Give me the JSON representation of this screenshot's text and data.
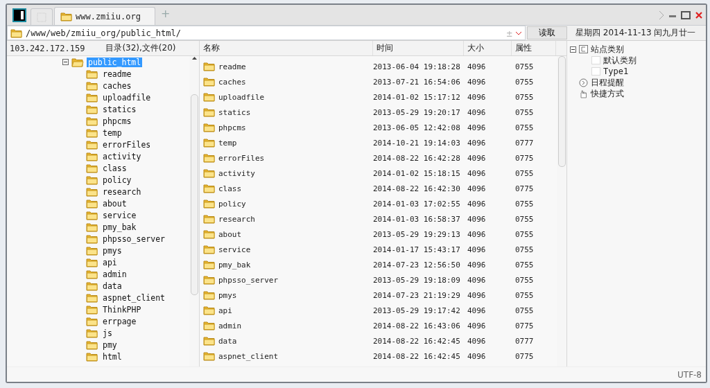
{
  "tabs": [
    {
      "kind": "blank",
      "selected": false
    },
    {
      "kind": "site",
      "label": "www.zmiiu.org",
      "selected": true
    }
  ],
  "new_tab_symbol": "+",
  "address": {
    "value": "/www/web/zmiiu_org/public_html/",
    "toggle_symbol": "±",
    "button": "读取"
  },
  "date_line": "星期四 2014-11-13 闰九月廿一",
  "tree_header": {
    "host": "103.242.172.159",
    "summary": "目录(32),文件(20)"
  },
  "tree": [
    {
      "label": "public_html",
      "expanded": true,
      "selected": true,
      "children": [
        {
          "label": "readme",
          "selected": false
        },
        {
          "label": "caches",
          "selected": false
        },
        {
          "label": "uploadfile",
          "selected": false
        },
        {
          "label": "statics",
          "selected": false
        },
        {
          "label": "phpcms",
          "selected": false
        },
        {
          "label": "temp",
          "selected": false
        },
        {
          "label": "errorFiles",
          "selected": false
        },
        {
          "label": "activity",
          "selected": false
        },
        {
          "label": "class",
          "selected": false
        },
        {
          "label": "policy",
          "selected": false
        },
        {
          "label": "research",
          "selected": false
        },
        {
          "label": "about",
          "selected": false
        },
        {
          "label": "service",
          "selected": false
        },
        {
          "label": "pmy_bak",
          "selected": false
        },
        {
          "label": "phpsso_server",
          "selected": false
        },
        {
          "label": "pmys",
          "selected": false
        },
        {
          "label": "api",
          "selected": false
        },
        {
          "label": "admin",
          "selected": false
        },
        {
          "label": "data",
          "selected": false
        },
        {
          "label": "aspnet_client",
          "selected": false
        },
        {
          "label": "ThinkPHP",
          "selected": false
        },
        {
          "label": "errpage",
          "selected": false
        },
        {
          "label": "js",
          "selected": false
        },
        {
          "label": "pmy",
          "selected": false
        },
        {
          "label": "html",
          "selected": false
        }
      ]
    }
  ],
  "table": {
    "columns": [
      "名称",
      "时间",
      "大小",
      "属性"
    ],
    "rows": [
      [
        "readme",
        "2013-06-04 19:18:28",
        "4096",
        "0755"
      ],
      [
        "caches",
        "2013-07-21 16:54:06",
        "4096",
        "0755"
      ],
      [
        "uploadfile",
        "2014-01-02 15:17:12",
        "4096",
        "0755"
      ],
      [
        "statics",
        "2013-05-29 19:20:17",
        "4096",
        "0755"
      ],
      [
        "phpcms",
        "2013-06-05 12:42:08",
        "4096",
        "0755"
      ],
      [
        "temp",
        "2014-10-21 19:14:03",
        "4096",
        "0777"
      ],
      [
        "errorFiles",
        "2014-08-22 16:42:28",
        "4096",
        "0775"
      ],
      [
        "activity",
        "2014-01-02 15:18:15",
        "4096",
        "0755"
      ],
      [
        "class",
        "2014-08-22 16:42:30",
        "4096",
        "0775"
      ],
      [
        "policy",
        "2014-01-03 17:02:55",
        "4096",
        "0755"
      ],
      [
        "research",
        "2014-01-03 16:58:37",
        "4096",
        "0755"
      ],
      [
        "about",
        "2013-05-29 19:29:13",
        "4096",
        "0755"
      ],
      [
        "service",
        "2014-01-17 15:43:17",
        "4096",
        "0755"
      ],
      [
        "pmy_bak",
        "2014-07-23 12:56:50",
        "4096",
        "0755"
      ],
      [
        "phpsso_server",
        "2013-05-29 19:18:09",
        "4096",
        "0755"
      ],
      [
        "pmys",
        "2014-07-23 21:19:29",
        "4096",
        "0755"
      ],
      [
        "api",
        "2013-05-29 19:17:42",
        "4096",
        "0755"
      ],
      [
        "admin",
        "2014-08-22 16:43:06",
        "4096",
        "0775"
      ],
      [
        "data",
        "2014-08-22 16:42:45",
        "4096",
        "0777"
      ],
      [
        "aspnet_client",
        "2014-08-22 16:42:45",
        "4096",
        "0775"
      ]
    ]
  },
  "side_tree": [
    {
      "label": "站点类别",
      "kind": "category-root",
      "expanded": true,
      "children": [
        {
          "label": "默认类别",
          "kind": "category"
        },
        {
          "label": "Type1",
          "kind": "category"
        }
      ]
    },
    {
      "label": "日程提醒",
      "kind": "schedule"
    },
    {
      "label": "快捷方式",
      "kind": "shortcut"
    }
  ],
  "status_bar": {
    "encoding": "UTF-8"
  }
}
